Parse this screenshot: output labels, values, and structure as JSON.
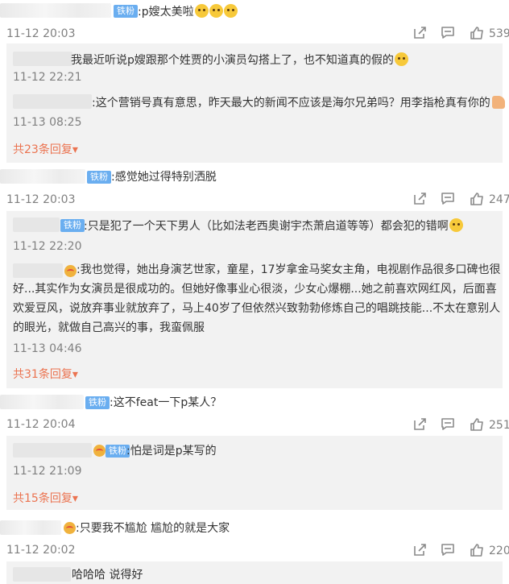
{
  "comments": [
    {
      "badge": "铁粉",
      "text": ":p嫂太美啦",
      "time": "11-12 20:03",
      "likes": "539",
      "replies": [
        {
          "text": "我最近听说p嫂跟那个姓贾的小演员勾搭上了，也不知道真的假的",
          "time": "11-12 22:21"
        },
        {
          "text": ":这个营销号真有意思，昨天最大的新闻不应该是海尔兄弟吗？用李指枪真有你的",
          "time": "11-13 08:25"
        }
      ],
      "more": "共23条回复"
    },
    {
      "badge": "铁粉",
      "text": ":感觉她过得特别洒脱",
      "time": "11-12 20:03",
      "likes": "247",
      "replies": [
        {
          "badge": "铁粉",
          "text": ":只是犯了一个天下男人（比如法老西奥谢宇杰萧启道等等）都会犯的错啊",
          "time": "11-12 22:20"
        },
        {
          "text": ":我也觉得，她出身演艺世家，童星，17岁拿金马奖女主角，电视剧作品很多口碑也很好...其实作为女演员是很成功的。但她好像事业心很淡，少女心爆棚...她之前喜欢网红风，后面喜欢爱豆风，说放弃事业就放弃了，马上40岁了但依然兴致勃勃修炼自己的唱跳技能...不太在意别人的眼光，就做自己高兴的事，我蛮佩服",
          "time": "11-13 04:46"
        }
      ],
      "more": "共31条回复"
    },
    {
      "badge": "铁粉",
      "text": ":这不feat一下p某人？",
      "time": "11-12 20:04",
      "likes": "251",
      "replies": [
        {
          "badge": "铁粉",
          "text": ":怕是词是p某写的",
          "time": "11-12 21:09"
        }
      ],
      "more": "共15条回复"
    },
    {
      "text": ":只要我不尴尬 尴尬的就是大家",
      "time": "11-12 20:02",
      "likes": "220"
    }
  ],
  "partial": {
    "text": "哈哈哈 说得好"
  },
  "icons": [
    "share-icon",
    "comment-icon",
    "like-icon"
  ],
  "colors": {
    "badge": "#6aaef0",
    "more_link": "#eb7350",
    "reply_bg": "#f2f2f2",
    "muted": "#808080"
  }
}
